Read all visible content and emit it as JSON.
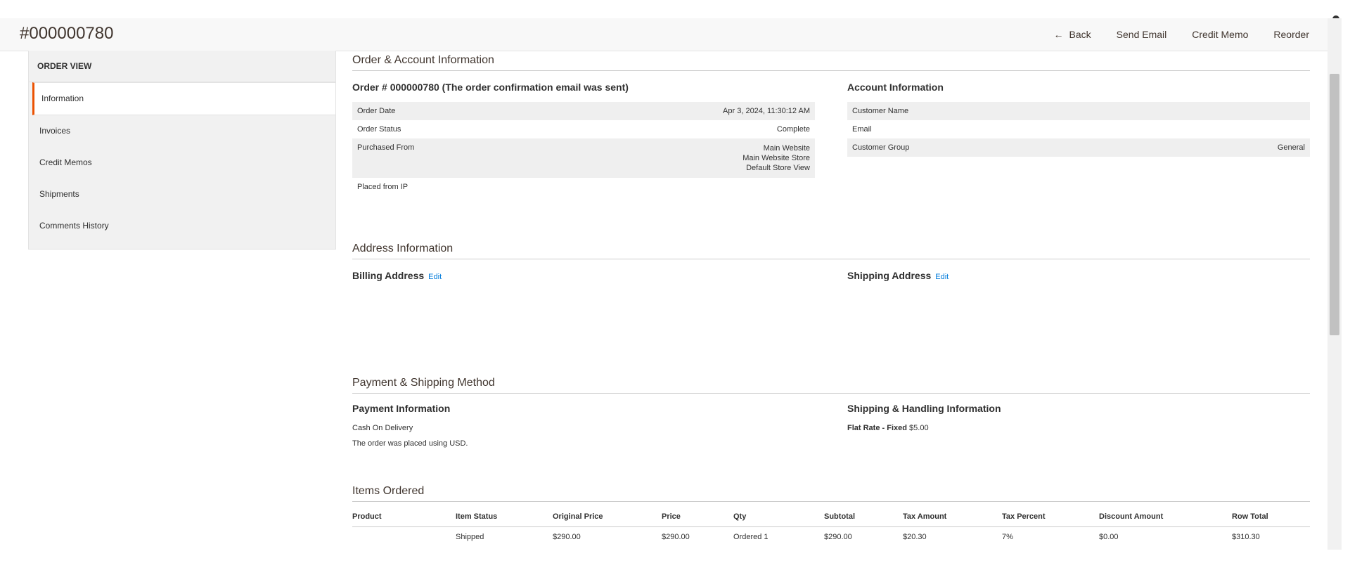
{
  "header": {
    "order_number": "#000000780",
    "actions": {
      "back": "Back",
      "send_email": "Send Email",
      "credit_memo": "Credit Memo",
      "reorder": "Reorder"
    }
  },
  "sidebar": {
    "heading": "ORDER VIEW",
    "items": [
      {
        "label": "Information",
        "active": true
      },
      {
        "label": "Invoices"
      },
      {
        "label": "Credit Memos"
      },
      {
        "label": "Shipments"
      },
      {
        "label": "Comments History"
      }
    ]
  },
  "order_account": {
    "section_title": "Order & Account Information",
    "order_heading": "Order # 000000780 (The order confirmation email was sent)",
    "order_rows": [
      {
        "label": "Order Date",
        "value": "Apr 3, 2024, 11:30:12 AM"
      },
      {
        "label": "Order Status",
        "value": "Complete"
      },
      {
        "label": "Purchased From",
        "value_lines": [
          "Main Website",
          "Main Website Store",
          "Default Store View"
        ]
      },
      {
        "label": "Placed from IP",
        "value": ""
      }
    ],
    "account_heading": "Account Information",
    "account_rows": [
      {
        "label": "Customer Name",
        "value": ""
      },
      {
        "label": "Email",
        "value": ""
      },
      {
        "label": "Customer Group",
        "value": "General"
      }
    ]
  },
  "address": {
    "section_title": "Address Information",
    "billing_heading": "Billing Address",
    "shipping_heading": "Shipping Address",
    "edit_label": "Edit"
  },
  "payment_shipping": {
    "section_title": "Payment & Shipping Method",
    "payment_heading": "Payment Information",
    "payment_method": "Cash On Delivery",
    "payment_note": "The order was placed using USD.",
    "shipping_heading": "Shipping & Handling Information",
    "shipping_method": "Flat Rate - Fixed",
    "shipping_price": "$5.00"
  },
  "items_ordered": {
    "section_title": "Items Ordered",
    "columns": [
      "Product",
      "Item Status",
      "Original Price",
      "Price",
      "Qty",
      "Subtotal",
      "Tax Amount",
      "Tax Percent",
      "Discount Amount",
      "Row Total"
    ],
    "rows": [
      [
        "",
        "Shipped",
        "$290.00",
        "$290.00",
        "Ordered 1",
        "$290.00",
        "$20.30",
        "7%",
        "$0.00",
        "$310.30"
      ]
    ]
  }
}
